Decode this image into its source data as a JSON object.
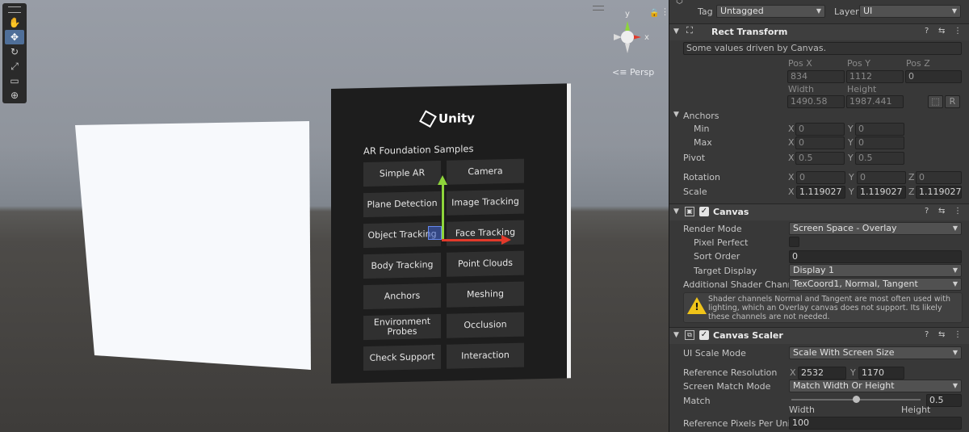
{
  "scene": {
    "persp_label": "Persp",
    "gizmo_axes": {
      "y": "y",
      "x": "x"
    },
    "tools": [
      "hand-icon",
      "move-icon",
      "rotate-icon",
      "scale-icon",
      "rect-icon",
      "transform-icon"
    ],
    "ar_canvas": {
      "logo_text": "Unity",
      "title": "AR Foundation Samples",
      "buttons": [
        "Simple AR",
        "Camera",
        "Plane Detection",
        "Image Tracking",
        "Object Tracking",
        "Face Tracking",
        "Body Tracking",
        "Point Clouds",
        "Anchors",
        "Meshing",
        "Environment Probes",
        "Occlusion",
        "Check Support",
        "Interaction"
      ]
    }
  },
  "inspector": {
    "tag_label": "Tag",
    "tag_value": "Untagged",
    "layer_label": "Layer",
    "layer_value": "UI",
    "rect_transform": {
      "title": "Rect Transform",
      "driven_note": "Some values driven by Canvas.",
      "pos_x_label": "Pos X",
      "pos_y_label": "Pos Y",
      "pos_z_label": "Pos Z",
      "pos_x": "834",
      "pos_y": "1112",
      "pos_z": "0",
      "width_label": "Width",
      "height_label": "Height",
      "width": "1490.58",
      "height": "1987.441",
      "r_button": "R",
      "anchors_label": "Anchors",
      "min_label": "Min",
      "min_x": "0",
      "min_y": "0",
      "max_label": "Max",
      "max_x": "0",
      "max_y": "0",
      "pivot_label": "Pivot",
      "pivot_x": "0.5",
      "pivot_y": "0.5",
      "rotation_label": "Rotation",
      "rot_x": "0",
      "rot_y": "0",
      "rot_z": "0",
      "scale_label": "Scale",
      "scale_x": "1.119027",
      "scale_y": "1.119027",
      "scale_z": "1.119027",
      "axis_x": "X",
      "axis_y": "Y",
      "axis_z": "Z"
    },
    "canvas": {
      "title": "Canvas",
      "render_mode_label": "Render Mode",
      "render_mode": "Screen Space - Overlay",
      "pixel_perfect_label": "Pixel Perfect",
      "sort_order_label": "Sort Order",
      "sort_order": "0",
      "target_display_label": "Target Display",
      "target_display": "Display 1",
      "shader_channel_label": "Additional Shader Channel",
      "shader_channel": "TexCoord1, Normal, Tangent",
      "warning": "Shader channels Normal and Tangent are most often used with lighting, which an Overlay canvas does not support. Its likely these channels are not needed."
    },
    "canvas_scaler": {
      "title": "Canvas Scaler",
      "scale_mode_label": "UI Scale Mode",
      "scale_mode": "Scale With Screen Size",
      "ref_res_label": "Reference Resolution",
      "ref_x": "2532",
      "ref_y": "1170",
      "match_mode_label": "Screen Match Mode",
      "match_mode": "Match Width Or Height",
      "match_label": "Match",
      "match_value": "0.5",
      "match_fraction": 0.5,
      "width_label": "Width",
      "height_label": "Height",
      "ppu_label": "Reference Pixels Per Unit",
      "ppu": "100"
    }
  },
  "colors": {
    "inspector_bg": "#383838",
    "field_bg": "#2a2a2a",
    "handle_y": "#8ed53b",
    "handle_x": "#e2392a",
    "selection_blue": "#4f6f99",
    "warning_yellow": "#f0c419"
  }
}
